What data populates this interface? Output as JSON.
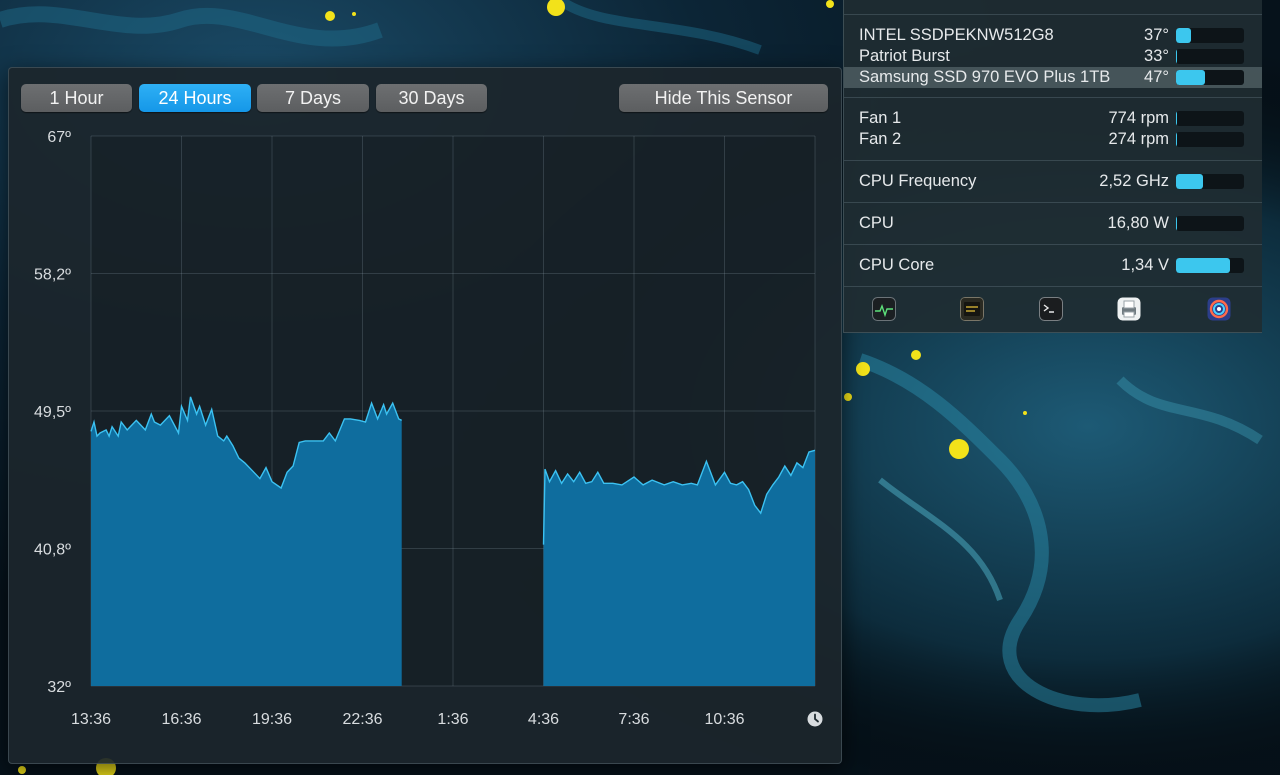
{
  "range_buttons": [
    {
      "label": "1 Hour",
      "active": false
    },
    {
      "label": "24 Hours",
      "active": true
    },
    {
      "label": "7 Days",
      "active": false
    },
    {
      "label": "30 Days",
      "active": false
    }
  ],
  "hide_sensor_label": "Hide This Sensor",
  "sensors": {
    "drives": [
      {
        "name": "INTEL SSDPEKNW512G8",
        "value": "37°",
        "level": 0.22
      },
      {
        "name": "Patriot Burst",
        "value": "33°",
        "level": 0.0
      },
      {
        "name": "Samsung SSD 970 EVO Plus 1TB",
        "value": "47°",
        "level": 0.42,
        "selected": true
      }
    ],
    "fans": [
      {
        "name": "Fan 1",
        "value": "774 rpm",
        "level": 0.02
      },
      {
        "name": "Fan 2",
        "value": "274 rpm",
        "level": 0.02
      }
    ],
    "cpu_frequency": {
      "name": "CPU Frequency",
      "value": "2,52 GHz",
      "level": 0.4
    },
    "cpu_power": {
      "name": "CPU",
      "value": "16,80 W",
      "level": 0.02
    },
    "cpu_core": {
      "name": "CPU Core",
      "value": "1,34 V",
      "level": 0.8
    }
  },
  "toolbar_icons": [
    "activity-monitor-icon",
    "console-icon",
    "terminal-icon",
    "printer-icon",
    "istat-menus-icon"
  ],
  "colors": {
    "accent": "#1ea4f0",
    "area_fill": "#0f6d9e",
    "area_line": "#3cc2f2",
    "bar_fill": "#3cc7ee"
  },
  "chart_data": {
    "type": "area",
    "title": "",
    "xlabel": "",
    "ylabel": "",
    "y_tick_labels": [
      "67º",
      "58,2º",
      "49,5º",
      "40,8º",
      "32º"
    ],
    "ylim": [
      32,
      67
    ],
    "x_tick_labels": [
      "13:36",
      "16:36",
      "19:36",
      "22:36",
      "1:36",
      "4:36",
      "7:36",
      "10:36"
    ],
    "grid": true,
    "x_unit": "hours since 13:36",
    "segments": [
      {
        "x": [
          0,
          0.1,
          0.2,
          0.3,
          0.5,
          0.6,
          0.7,
          0.9,
          1.0,
          1.2,
          1.5,
          1.8,
          2.0,
          2.1,
          2.3,
          2.6,
          2.9,
          3.0,
          3.2,
          3.3,
          3.5,
          3.6,
          3.8,
          4.0,
          4.2,
          4.4,
          4.5,
          4.7,
          4.9,
          5.1,
          5.4,
          5.6,
          5.8,
          6.0,
          6.3,
          6.5,
          6.7,
          6.9,
          7.1,
          7.3,
          7.5,
          7.7,
          7.9,
          8.1,
          8.4,
          8.6,
          8.9,
          9.1,
          9.3,
          9.5,
          9.7,
          9.8,
          10.0,
          10.2,
          10.3
        ],
        "y": [
          48.2,
          48.8,
          47.9,
          48.1,
          48.3,
          47.9,
          48.5,
          47.9,
          48.8,
          48.3,
          48.9,
          48.3,
          49.3,
          48.8,
          48.6,
          49.2,
          48.1,
          49.8,
          48.9,
          50.4,
          49.3,
          49.8,
          48.6,
          49.6,
          47.9,
          47.6,
          47.9,
          47.3,
          46.5,
          46.2,
          45.6,
          45.2,
          45.9,
          45.0,
          44.6,
          45.6,
          46.0,
          47.5,
          47.6,
          47.6,
          47.6,
          47.6,
          48.1,
          47.6,
          49.0,
          49.0,
          48.9,
          48.8,
          50.0,
          49.0,
          49.9,
          49.3,
          50.0,
          49.0,
          48.9
        ]
      },
      {
        "x": [
          15.0,
          15.05,
          15.2,
          15.4,
          15.6,
          15.8,
          16.0,
          16.2,
          16.4,
          16.6,
          16.8,
          17.0,
          17.3,
          17.6,
          18.0,
          18.3,
          18.6,
          19.0,
          19.3,
          19.6,
          19.9,
          20.1,
          20.4,
          20.7,
          21.0,
          21.2,
          21.4,
          21.6,
          21.8,
          22.0,
          22.2,
          22.4,
          22.6,
          22.8,
          23.0,
          23.2,
          23.4,
          23.6,
          23.8,
          24.0
        ],
        "y": [
          41.0,
          45.8,
          45.0,
          45.7,
          44.9,
          45.5,
          45.0,
          45.6,
          44.9,
          45.0,
          45.6,
          44.9,
          44.9,
          44.8,
          45.3,
          44.8,
          45.1,
          44.8,
          45.0,
          44.8,
          44.9,
          44.8,
          46.3,
          44.8,
          45.6,
          44.9,
          44.8,
          45.0,
          44.5,
          43.5,
          43.0,
          44.2,
          44.8,
          45.3,
          46.0,
          45.4,
          46.2,
          45.9,
          46.9,
          47.0
        ]
      }
    ]
  }
}
